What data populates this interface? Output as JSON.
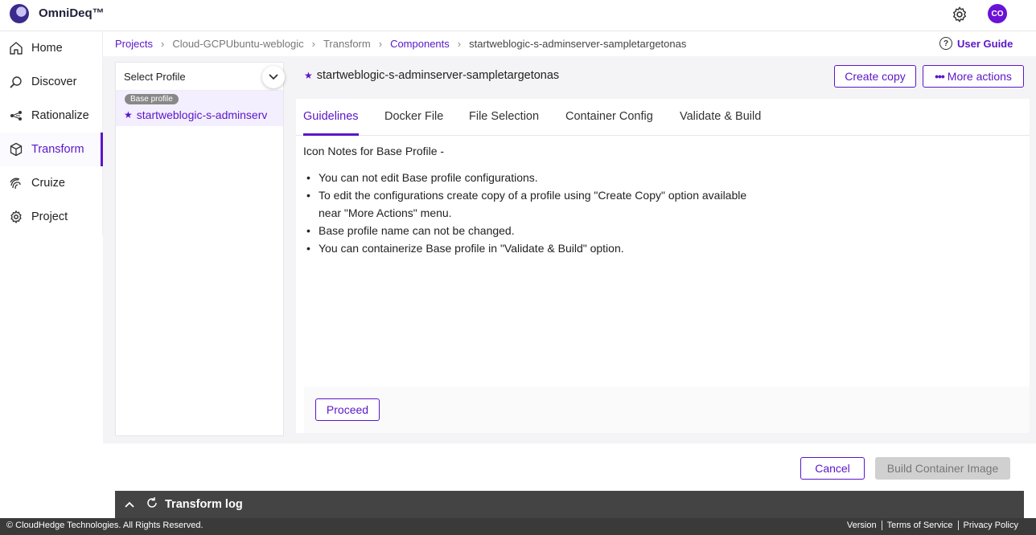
{
  "header": {
    "brand": "OmniDeq™",
    "avatar_initials": "CO",
    "settings_icon": "gear-icon"
  },
  "sidebar": {
    "items": [
      {
        "label": "Home",
        "icon": "home-icon",
        "active": false
      },
      {
        "label": "Discover",
        "icon": "search-icon",
        "active": false
      },
      {
        "label": "Rationalize",
        "icon": "rationalize-icon",
        "active": false
      },
      {
        "label": "Transform",
        "icon": "cube-icon",
        "active": true
      },
      {
        "label": "Cruize",
        "icon": "fingerprint-icon",
        "active": false
      },
      {
        "label": "Project",
        "icon": "gear-icon",
        "active": false
      }
    ]
  },
  "breadcrumb": {
    "items": [
      "Projects",
      "Cloud-GCPUbuntu-weblogic",
      "Transform",
      "Components",
      "startweblogic-s-adminserver-sampletargetonas"
    ],
    "user_guide": "User Guide"
  },
  "profiles": {
    "select_label": "Select Profile",
    "items": [
      {
        "badge": "Base profile",
        "name": "startweblogic-s-adminserver-sampletargetonas"
      }
    ]
  },
  "content": {
    "title": "startweblogic-s-adminserver-sampletargetonas",
    "create_copy": "Create copy",
    "more_actions": "More actions",
    "tabs": [
      "Guidelines",
      "Docker File",
      "File Selection",
      "Container Config",
      "Validate & Build"
    ],
    "active_tab": "Guidelines",
    "notes_title": "Icon Notes for Base Profile -",
    "notes": [
      "You can not edit Base profile configurations.",
      "To edit the configurations create copy of a profile using \"Create Copy\" option available near \"More Actions\" menu.",
      "Base profile name can not be changed.",
      "You can containerize Base profile in \"Validate & Build\" option."
    ],
    "proceed": "Proceed"
  },
  "actions": {
    "cancel": "Cancel",
    "build": "Build Container Image"
  },
  "transform_log": {
    "label": "Transform log"
  },
  "footer": {
    "copyright": "© CloudHedge Technologies. All Rights Reserved.",
    "links": [
      "Version",
      "Terms of Service",
      "Privacy Policy"
    ]
  },
  "colors": {
    "accent": "#5a16c8",
    "footer_bg": "#3a3a3a",
    "log_bg": "#444444"
  }
}
